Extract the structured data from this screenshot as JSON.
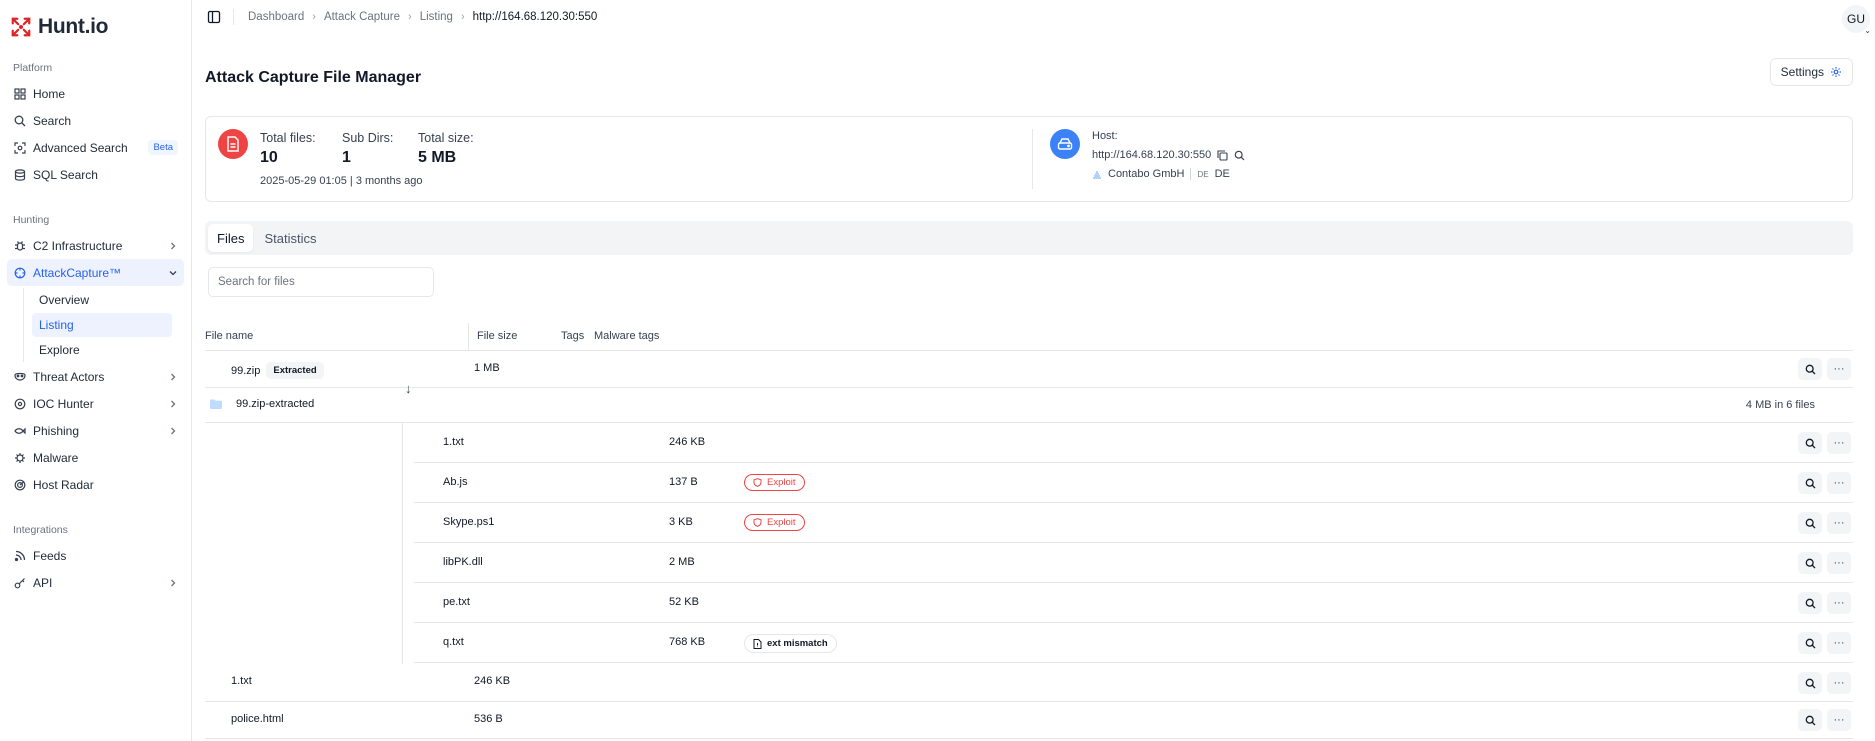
{
  "brand": {
    "name": "Hunt.io"
  },
  "sidebar": {
    "platform_label": "Platform",
    "hunting_label": "Hunting",
    "integrations_label": "Integrations",
    "platform": [
      {
        "label": "Home",
        "icon": "grid-icon"
      },
      {
        "label": "Search",
        "icon": "search-icon"
      },
      {
        "label": "Advanced Search",
        "icon": "scan-icon",
        "badge": "Beta"
      },
      {
        "label": "SQL Search",
        "icon": "database-icon"
      }
    ],
    "hunting": [
      {
        "label": "C2 Infrastructure",
        "icon": "bug-icon"
      },
      {
        "label": "AttackCapture™",
        "icon": "crosshair-icon",
        "active": true,
        "children": [
          "Overview",
          "Listing",
          "Explore"
        ]
      },
      {
        "label": "Threat Actors",
        "icon": "mask-icon"
      },
      {
        "label": "IOC Hunter",
        "icon": "target-icon"
      },
      {
        "label": "Phishing",
        "icon": "fish-icon"
      },
      {
        "label": "Malware",
        "icon": "virus-icon"
      },
      {
        "label": "Host Radar",
        "icon": "radar-icon"
      }
    ],
    "integrations": [
      {
        "label": "Feeds",
        "icon": "rss-icon"
      },
      {
        "label": "API",
        "icon": "key-icon"
      }
    ]
  },
  "breadcrumbs": [
    "Dashboard",
    "Attack Capture",
    "Listing",
    "http://164.68.120.30:550"
  ],
  "user": {
    "initials": "GU"
  },
  "page": {
    "title": "Attack Capture File Manager",
    "settings_label": "Settings"
  },
  "summary": {
    "total_files_label": "Total files:",
    "total_files": "10",
    "sub_dirs_label": "Sub Dirs:",
    "sub_dirs": "1",
    "total_size_label": "Total size:",
    "total_size": "5 MB",
    "date": "2025-05-29 01:05 | 3 months ago",
    "host_label": "Host:",
    "host_url": "http://164.68.120.30:550",
    "provider": "Contabo GmbH",
    "country_code": "DE",
    "country": "DE"
  },
  "tabs": [
    "Files",
    "Statistics"
  ],
  "search": {
    "placeholder": "Search for files"
  },
  "table": {
    "headers": [
      "File name",
      "File size",
      "Tags",
      "Malware tags"
    ],
    "rows": [
      {
        "name": "99.zip",
        "size": "1 MB",
        "badge": "Extracted"
      },
      {
        "name": "99.zip-extracted",
        "folder_info": "4 MB in 6 files"
      },
      {
        "name": "1.txt",
        "size": "246 KB"
      },
      {
        "name": "Ab.js",
        "size": "137 B",
        "tag": "Exploit"
      },
      {
        "name": "Skype.ps1",
        "size": "3 KB",
        "tag": "Exploit"
      },
      {
        "name": "libPK.dll",
        "size": "2 MB"
      },
      {
        "name": "pe.txt",
        "size": "52 KB"
      },
      {
        "name": "q.txt",
        "size": "768 KB",
        "tag": "ext mismatch"
      },
      {
        "name": "1.txt",
        "size": "246 KB"
      },
      {
        "name": "police.html",
        "size": "536 B"
      }
    ]
  },
  "colors": {
    "accent": "#2563eb",
    "danger": "#ef4444",
    "host": "#3b82f6"
  }
}
